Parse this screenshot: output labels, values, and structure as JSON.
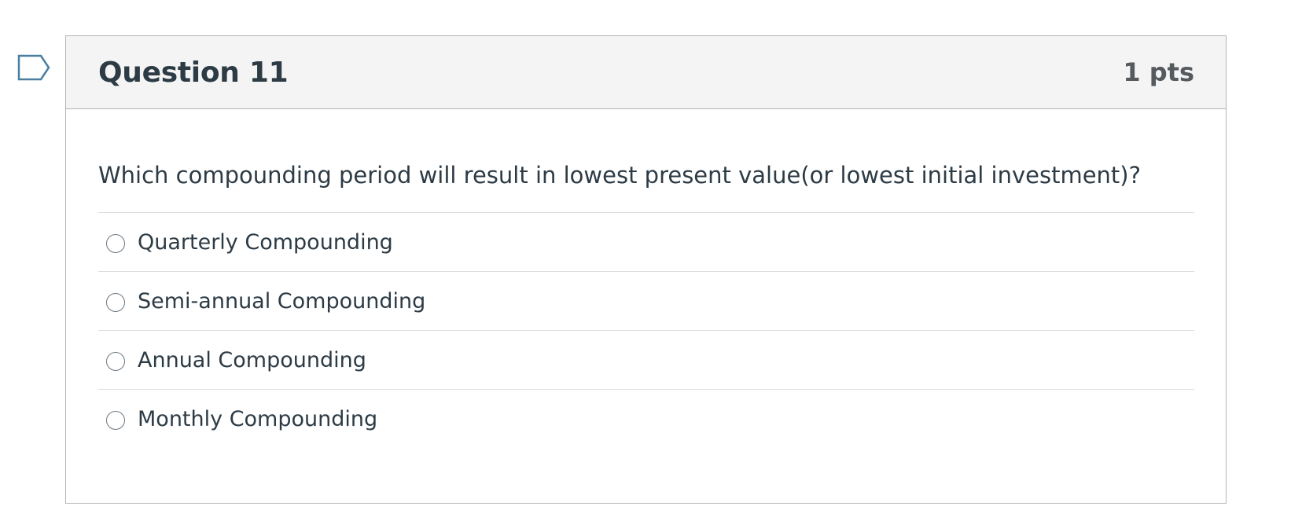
{
  "question": {
    "title": "Question 11",
    "points": "1 pts",
    "text": "Which compounding period will result in lowest present value(or lowest initial investment)?",
    "flag_icon": "flag-bookmark-icon",
    "answers": [
      {
        "label": "Quarterly Compounding",
        "selected": false
      },
      {
        "label": "Semi-annual Compounding",
        "selected": false
      },
      {
        "label": "Annual Compounding",
        "selected": false
      },
      {
        "label": "Monthly Compounding",
        "selected": false
      }
    ]
  },
  "colors": {
    "header_bg": "#f4f4f4",
    "border": "#b4b4b4",
    "divider": "#dcdcdc",
    "text": "#2d3b45",
    "flag_stroke": "#4a7fa0"
  }
}
